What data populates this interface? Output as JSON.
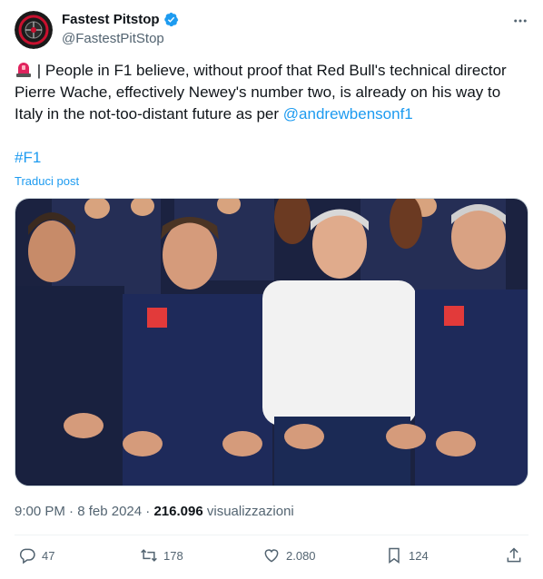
{
  "author": {
    "display_name": "Fastest Pitstop",
    "handle": "@FastestPitStop",
    "verified": true
  },
  "tweet": {
    "siren_icon": "police-light-emoji",
    "text_before_mention": " | People in F1 believe, without proof that Red Bull's technical director Pierre Wache, effectively Newey's number two, is already on his way to Italy in the not-too-distant future as per ",
    "mention": "@andrewbensonf1",
    "hashtag": "#F1",
    "translate_label": "Traduci post"
  },
  "meta": {
    "time": "9:00 PM",
    "separator1": " · ",
    "date": "8 feb 2024",
    "separator2": " · ",
    "views_count": "216.096",
    "views_label": " visualizzazioni"
  },
  "actions": {
    "replies": "47",
    "reposts": "178",
    "likes": "2.080",
    "bookmarks": "124"
  },
  "colors": {
    "accent": "#1d9bf0",
    "secondary_text": "#536471"
  }
}
